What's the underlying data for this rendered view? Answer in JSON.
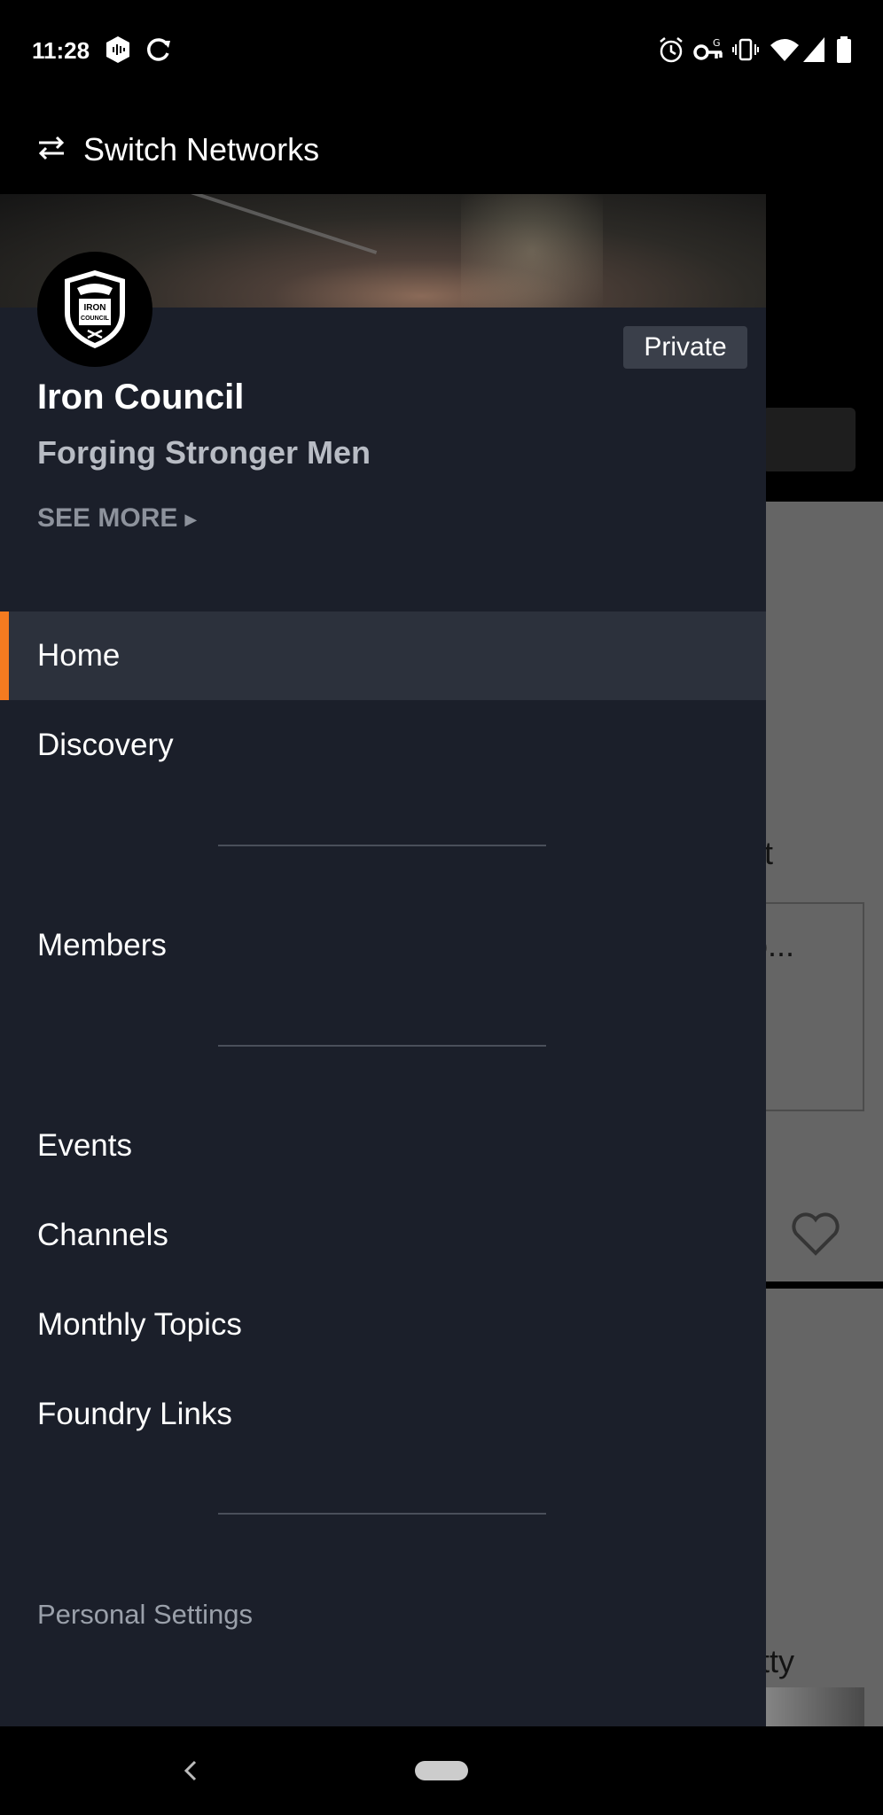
{
  "status_bar": {
    "time": "11:28"
  },
  "background": {
    "snippets": [
      "art",
      "/co...",
      "retty"
    ]
  },
  "header": {
    "switch_networks": "Switch Networks"
  },
  "network": {
    "name": "Iron Council",
    "tagline": "Forging Stronger Men",
    "privacy": "Private",
    "see_more": "SEE MORE",
    "logo_text": [
      "IRON",
      "COUNCIL"
    ]
  },
  "menu": {
    "home": "Home",
    "discovery": "Discovery",
    "members": "Members",
    "events": "Events",
    "channels": "Channels",
    "monthly_topics": "Monthly Topics",
    "foundry_links": "Foundry Links",
    "personal_settings": "Personal Settings"
  },
  "colors": {
    "drawer_bg": "#1b1f2a",
    "active_item_bg": "#2c313c",
    "accent": "#f47b20"
  }
}
